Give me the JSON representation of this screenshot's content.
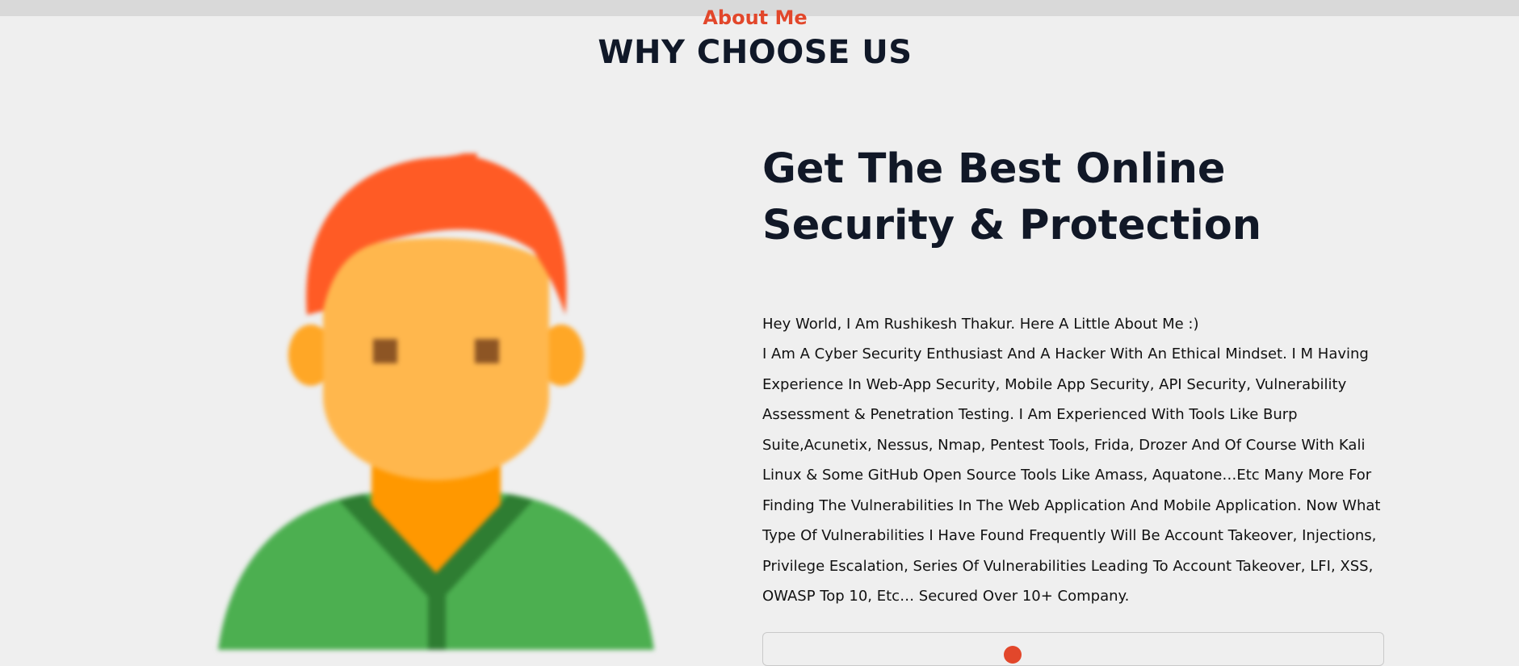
{
  "header": {
    "kicker": "About Me",
    "title": "WHY CHOOSE US"
  },
  "about": {
    "headline": "Get The Best Online Security & Protection",
    "intro": "Hey World, I Am Rushikesh Thakur. Here A Little About Me :)",
    "bio": "I Am A Cyber Security Enthusiast And A Hacker With An Ethical Mindset. I M Having Experience In Web-App Security, Mobile App Security, API Security, Vulnerability Assessment & Penetration Testing. I Am Experienced With Tools Like Burp Suite,Acunetix, Nessus, Nmap, Pentest Tools, Frida, Drozer And Of Course With Kali Linux & Some GitHub Open Source Tools Like Amass, Aquatone…Etc Many More For Finding The Vulnerabilities In The Web Application And Mobile Application. Now What Type Of Vulnerabilities I Have Found Frequently Will Be Account Takeover, Injections, Privilege Escalation, Series Of Vulnerabilities Leading To Account Takeover, LFI, XSS, OWASP Top 10, Etc… Secured Over 10+ Company."
  },
  "avatar": {
    "icon": "user-avatar-icon",
    "hair_color": "#ff5b25",
    "skin_color": "#ffb74d",
    "neck_color": "#ff9800",
    "shirt_color": "#4caf50",
    "collar_color": "#2e7d32",
    "eye_color": "#8d5524"
  },
  "contact": {
    "icon": "accent-circle-icon",
    "accent_color": "#e2472b"
  }
}
